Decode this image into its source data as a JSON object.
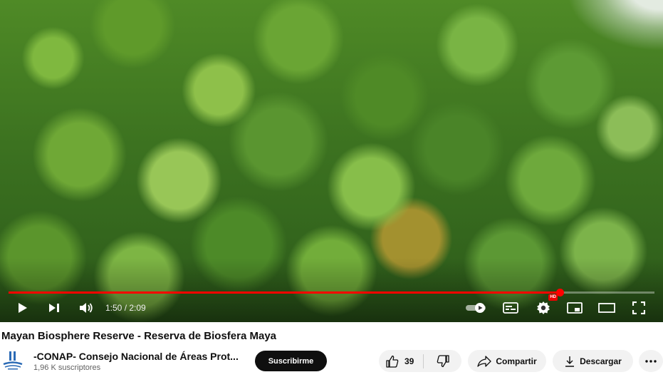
{
  "player": {
    "current_time": "1:50",
    "duration": "2:09",
    "time_display": "1:50 / 2:09",
    "progress_fraction": 0.853,
    "hd_badge": "HD",
    "colors": {
      "progress": "#ff0000"
    },
    "icons": [
      "play-icon",
      "next-icon",
      "volume-icon",
      "autoplay-toggle-icon",
      "subtitles-icon",
      "settings-icon",
      "miniplayer-icon",
      "theater-icon",
      "fullscreen-icon"
    ]
  },
  "video": {
    "title": "Mayan Biosphere Reserve - Reserva de Biosfera Maya"
  },
  "channel": {
    "name": "-CONAP- Consejo Nacional de Áreas Prot...",
    "subscribers": "1,96 K suscriptores",
    "subscribe_label": "Suscribirme"
  },
  "actions": {
    "like_count": "39",
    "share_label": "Compartir",
    "download_label": "Descargar"
  }
}
